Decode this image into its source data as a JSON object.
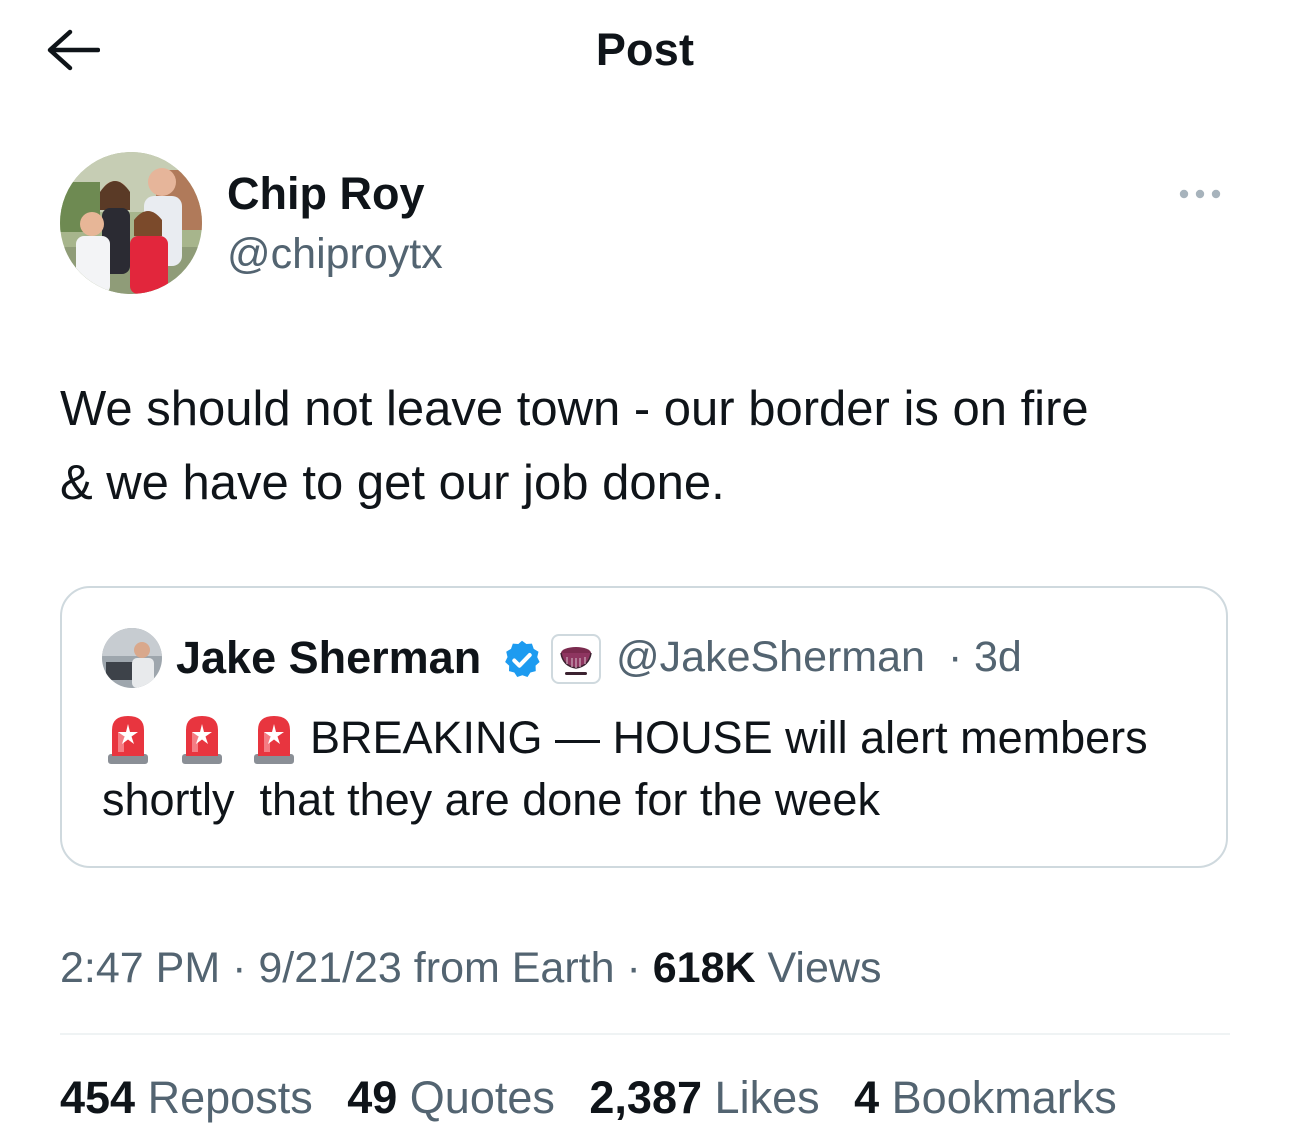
{
  "header": {
    "title": "Post",
    "back_icon": "arrow-left-icon"
  },
  "author": {
    "name": "Chip Roy",
    "handle": "@chiproytx",
    "more_icon": "more-horizontal-icon"
  },
  "tweet": {
    "text": "We should not leave town - our border is on fire\n& we have to get our job done."
  },
  "quote": {
    "name": "Jake Sherman",
    "handle": "@JakeSherman",
    "separator": "·",
    "time": "3d",
    "verified_icon": "verified-badge-icon",
    "affiliation_icon": "affiliate-badge-icon",
    "siren_icon": "police-siren-emoji",
    "text_line1": "BREAKING — HOUSE will alert members",
    "text_line2": "shortly  that they are done for the week"
  },
  "meta": {
    "time": "2:47 PM",
    "date": "9/21/23",
    "source": "from Earth",
    "views_count": "618K",
    "views_label": "Views"
  },
  "stats": {
    "reposts_count": "454",
    "reposts_label": "Reposts",
    "quotes_count": "49",
    "quotes_label": "Quotes",
    "likes_count": "2,387",
    "likes_label": "Likes",
    "bookmarks_count": "4",
    "bookmarks_label": "Bookmarks"
  },
  "colors": {
    "text_primary": "#0f1419",
    "text_secondary": "#536471",
    "border": "#cfd9de",
    "verified_blue": "#1d9bf0",
    "siren_red": "#e8353f"
  }
}
